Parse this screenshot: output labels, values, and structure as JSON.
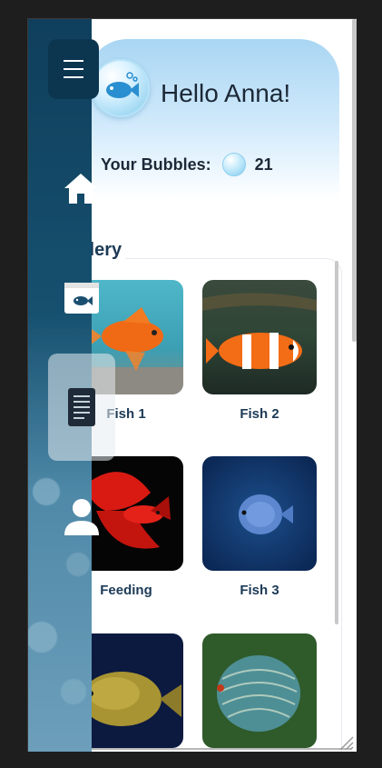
{
  "header": {
    "greeting": "Hello Anna!",
    "bubbles_label": "Your Bubbles:",
    "bubbles_count": "21"
  },
  "sidebar": {
    "items": [
      {
        "icon": "home-icon"
      },
      {
        "icon": "aquarium-icon"
      },
      {
        "icon": "notes-icon",
        "active": true
      },
      {
        "icon": "profile-icon"
      }
    ]
  },
  "gallery": {
    "title": "Gallery",
    "visible_title": "llery",
    "tiles": [
      {
        "caption": "Fish 1"
      },
      {
        "caption": "Fish 2"
      },
      {
        "caption": "Feeding"
      },
      {
        "caption": "Fish 3"
      },
      {
        "caption": ""
      },
      {
        "caption": ""
      }
    ]
  },
  "colors": {
    "sidebar": "#0f3f5c",
    "menu_button": "#0c3550",
    "header_gradient": "#a9d6f3",
    "text_dark": "#1c2836",
    "caption": "#1c3a56"
  }
}
